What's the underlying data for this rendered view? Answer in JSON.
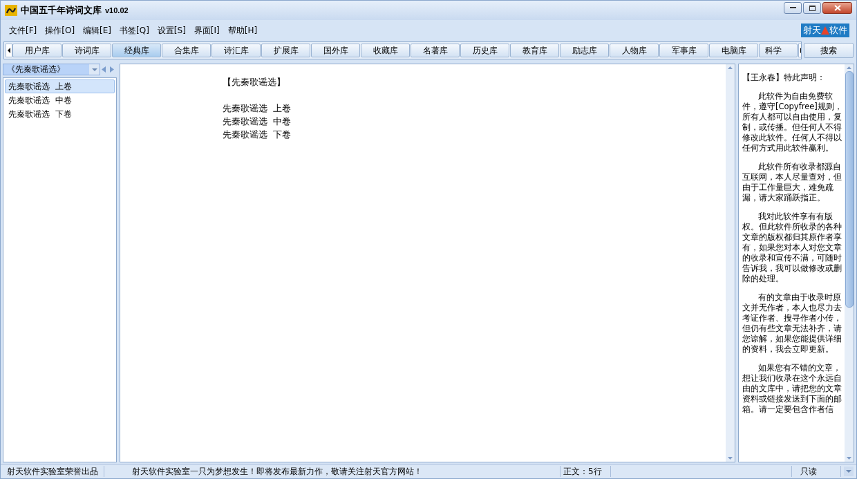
{
  "window": {
    "title": "中国五千年诗词文库",
    "version": "v10.02"
  },
  "menu": [
    "文件[F]",
    "操作[O]",
    "编辑[E]",
    "书签[Q]",
    "设置[S]",
    "界面[I]",
    "帮助[H]"
  ],
  "logo": {
    "left": "射天",
    "right": "软件"
  },
  "tabs": [
    {
      "label": "用户库",
      "selected": false
    },
    {
      "label": "诗词库",
      "selected": false
    },
    {
      "label": "经典库",
      "selected": true
    },
    {
      "label": "合集库",
      "selected": false
    },
    {
      "label": "诗汇库",
      "selected": false
    },
    {
      "label": "扩展库",
      "selected": false
    },
    {
      "label": "国外库",
      "selected": false
    },
    {
      "label": "收藏库",
      "selected": false
    },
    {
      "label": "名著库",
      "selected": false
    },
    {
      "label": "历史库",
      "selected": false
    },
    {
      "label": "教育库",
      "selected": false
    },
    {
      "label": "励志库",
      "selected": false
    },
    {
      "label": "人物库",
      "selected": false
    },
    {
      "label": "军事库",
      "selected": false
    },
    {
      "label": "电脑库",
      "selected": false
    },
    {
      "label": "科学",
      "selected": false
    }
  ],
  "search_button": "搜索",
  "sidebar": {
    "book": "《先秦歌谣选》",
    "items": [
      {
        "label": "先秦歌谣选  上卷",
        "selected": true
      },
      {
        "label": "先秦歌谣选  中卷",
        "selected": false
      },
      {
        "label": "先秦歌谣选  下卷",
        "selected": false
      }
    ]
  },
  "document": {
    "title": "【先秦歌谣选】",
    "lines": [
      "先秦歌谣选  上卷",
      "先秦歌谣选  中卷",
      "先秦歌谣选  下卷"
    ]
  },
  "notice": {
    "heading": "【王永春】特此声明：",
    "paragraphs": [
      "此软件为自由免费软件，遵守[Copyfree]规则，所有人都可以自由使用，复制，或传播。但任何人不得修改此软件。任何人不得以任何方式用此软件赢利。",
      "此软件所有收录都源自互联网，本人尽量查对，但由于工作量巨大，难免疏漏，请大家踊跃指正。",
      "我对此软件享有有版权。但此软件所收录的各种文章的版权都归其原作者享有，如果您对本人对您文章的收录和宣传不满，可随时告诉我，我可以做修改或删除的处理。",
      "有的文章由于收录时原文并无作者，本人也尽力去考证作者、搜寻作者小传，但仍有些文章无法补齐，请您谅解，如果您能提供详细的资料，我会立即更新。",
      "如果您有不错的文章，想让我们收录在这个永远自由的文库中，请把您的文章资料或链接发送到下面的邮箱。请一定要包含作者信"
    ]
  },
  "status_bar": {
    "credit": "射天软件实验室荣誉出品",
    "message": "射天软件实验室一只为梦想发生！即将发布最新力作，敬请关注射天官方网站！",
    "line_count": "正文：5行",
    "mode": "只读"
  }
}
